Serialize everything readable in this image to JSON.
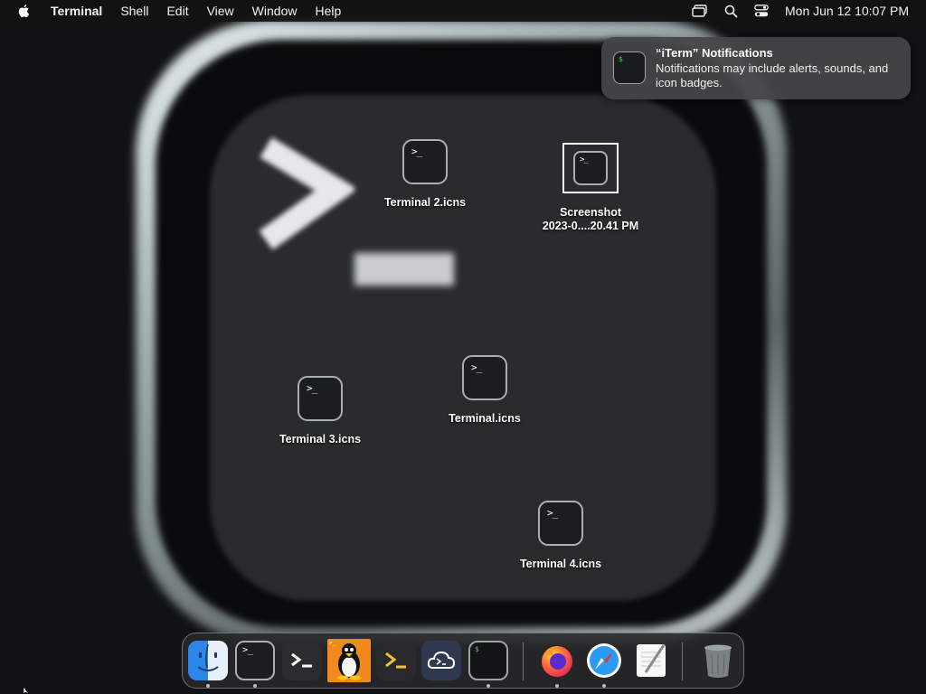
{
  "menubar": {
    "apple_icon": "apple-logo-icon",
    "app_name": "Terminal",
    "menus": [
      "Shell",
      "Edit",
      "View",
      "Window",
      "Help"
    ],
    "status_icons": [
      "screen-mirroring-icon",
      "spotlight-search-icon",
      "control-center-icon"
    ],
    "clock": "Mon Jun 12  10:07 PM"
  },
  "notification": {
    "app_icon": "iterm-icon",
    "icon_glyph": "$",
    "title": "“iTerm” Notifications",
    "body": "Notifications may include alerts, sounds, and icon badges."
  },
  "desktop": {
    "icon_glyph": ">_",
    "icons": [
      {
        "label": "Terminal 2.icns",
        "selected": false
      },
      {
        "label": "Screenshot\n2023-0....20.41 PM",
        "selected": true
      },
      {
        "label": "Terminal 3.icns",
        "selected": false
      },
      {
        "label": "Terminal.icns",
        "selected": false
      },
      {
        "label": "Terminal 4.icns",
        "selected": false
      }
    ]
  },
  "dock": {
    "apps": [
      {
        "name": "Finder",
        "icon": "finder-icon",
        "running": true
      },
      {
        "name": "Terminal",
        "icon": "terminal-icon",
        "running": true
      },
      {
        "name": "Terminal Preview",
        "icon": "terminal-dark-icon",
        "running": false
      },
      {
        "name": "Linux",
        "icon": "tux-penguin-icon",
        "running": false
      },
      {
        "name": "Prompt",
        "icon": "yellow-prompt-icon",
        "running": false
      },
      {
        "name": "Cloud Shell",
        "icon": "cloud-shell-icon",
        "running": false
      },
      {
        "name": "iTerm",
        "icon": "iterm-icon",
        "running": true
      },
      {
        "name": "Firefox",
        "icon": "firefox-icon",
        "running": true
      },
      {
        "name": "Safari",
        "icon": "safari-icon",
        "running": true
      },
      {
        "name": "TextEdit",
        "icon": "textedit-icon",
        "running": false
      },
      {
        "name": "Trash",
        "icon": "trash-icon",
        "running": false
      }
    ]
  },
  "colors": {
    "menubar_bg": "#121214",
    "notification_bg": "#464648",
    "finder_blue": "#2a86e8",
    "tux_orange": "#f08a1c",
    "iterm_green": "#39d353"
  }
}
